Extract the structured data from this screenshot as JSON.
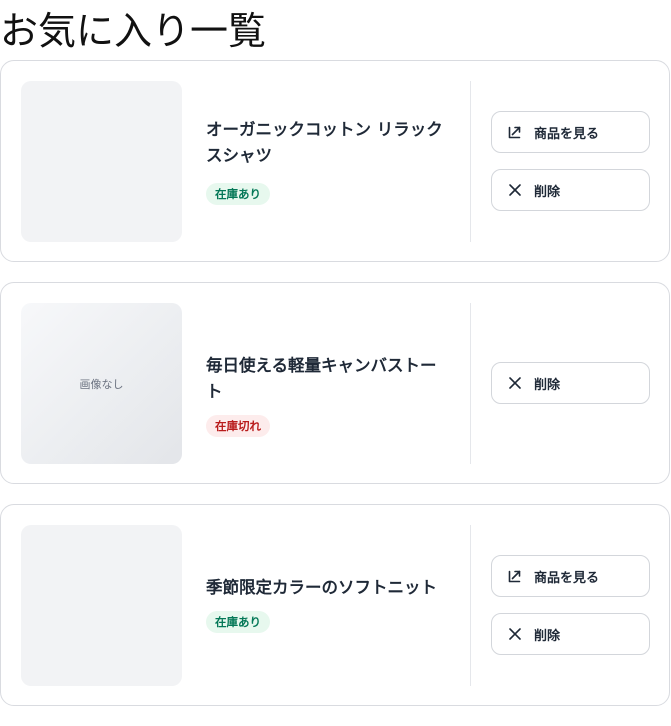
{
  "page": {
    "title": "お気に入り一覧"
  },
  "items": [
    {
      "name": "オーガニックコットン リラックスシャツ",
      "stock_label": "在庫あり",
      "thumb_text": "",
      "view_label": "商品を見る",
      "delete_label": "削除"
    },
    {
      "name": "毎日使える軽量キャンバストート",
      "stock_label": "在庫切れ",
      "thumb_text": "画像なし",
      "delete_label": "削除"
    },
    {
      "name": "季節限定カラーのソフトニット",
      "stock_label": "在庫あり",
      "thumb_text": "",
      "view_label": "商品を見る",
      "delete_label": "削除"
    }
  ],
  "icons": {
    "view": "external-link-icon",
    "delete": "close-icon"
  },
  "colors": {
    "in_stock_bg": "#e7f8ee",
    "in_stock_text": "#047857",
    "out_stock_bg": "#fdecec",
    "out_stock_text": "#b91c1c",
    "border": "#d9dbe0"
  }
}
